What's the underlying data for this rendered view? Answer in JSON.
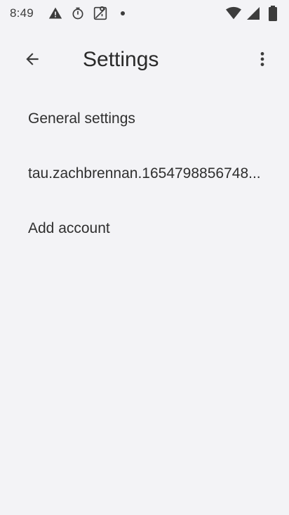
{
  "status_bar": {
    "time": "8:49",
    "left_icons": [
      "alert-triangle-icon",
      "timer-icon",
      "location-off-icon",
      "dot-icon"
    ],
    "right_icons": [
      "wifi-icon",
      "cell-signal-icon",
      "battery-icon"
    ]
  },
  "app_bar": {
    "title": "Settings",
    "back_icon": "back-arrow-icon",
    "overflow_icon": "more-vertical-icon"
  },
  "list": {
    "items": [
      {
        "label": "General settings"
      },
      {
        "label": "tau.zachbrennan.1654798856748..."
      },
      {
        "label": "Add account"
      }
    ]
  },
  "colors": {
    "background": "#f3f3f6",
    "text": "#2f2f2f",
    "icon": "#3c3c3c"
  }
}
